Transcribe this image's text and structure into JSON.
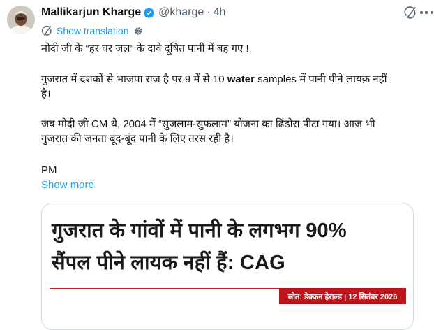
{
  "author": {
    "name": "Mallikarjun Kharge",
    "handle": "@kharge",
    "separator": "·",
    "time": "4h"
  },
  "actions": {
    "translate_label": "Show translation",
    "show_more_label": "Show more"
  },
  "tweet": {
    "line1": "मोदी जी के “हर घर जल” के दावे दूषित पानी में बह गए !",
    "line2_pre": "गुजरात में दशकों से भाजपा राज है पर 9 में से 10 ",
    "line2_bold": "water",
    "line2_post": " samples में पानी पीने लायक़ नहीं",
    "line3": "है।",
    "line4": "जब मोदी जी CM थे, 2004 में “सुजलाम-सुफलाम” योजना का ढिंढोरा पीटा गया। आज भी",
    "line5": "गुजरात की जनता बूंद-बूंद पानी के लिए तरस रही है।",
    "line6": "PM"
  },
  "card": {
    "headline1": "गुजरात के गांवों में पानी के लगभग 90%",
    "headline2": "सैंपल पीने लायक नहीं हैं: CAG",
    "source": "स्रोत: डेक्कन हेराल्ड | 12 सितंबर 2026"
  },
  "colors": {
    "link": "#1d9bf0",
    "verified": "#1d9bf0",
    "source_red": "#c0141b",
    "muted": "#536471"
  },
  "icons": [
    "verified-badge-icon",
    "grok-icon",
    "more-options-icon",
    "translate-icon",
    "gear-icon"
  ]
}
